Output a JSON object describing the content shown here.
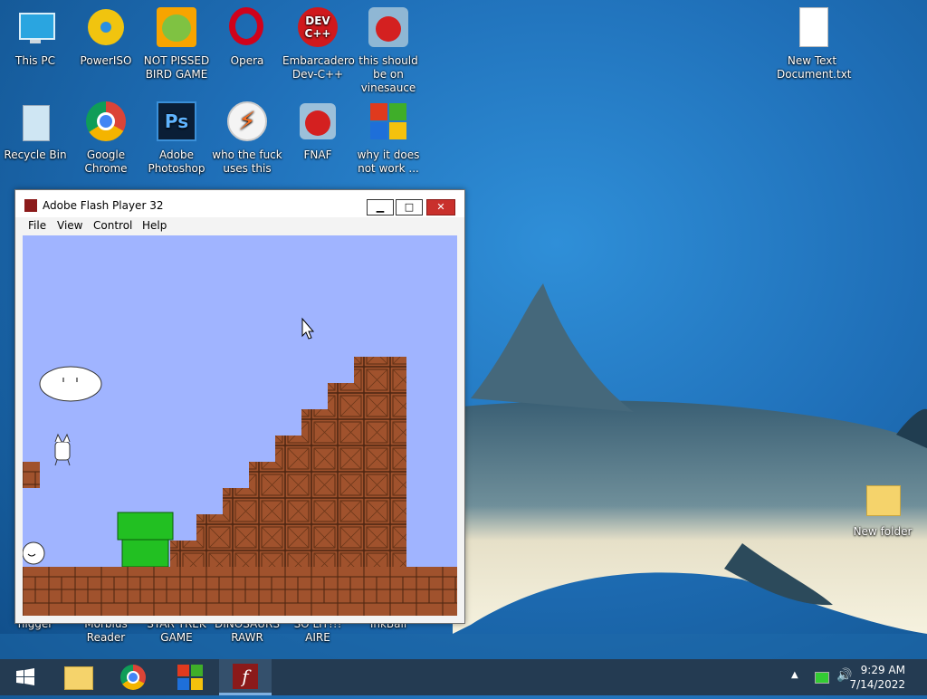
{
  "desktop": {
    "icons": [
      {
        "label": "This PC"
      },
      {
        "label": "PowerISO"
      },
      {
        "label": "NOT PISSED BIRD GAME"
      },
      {
        "label": "Opera"
      },
      {
        "label": "Embarcadero Dev-C++"
      },
      {
        "label": "this should be on vinesauce"
      },
      {
        "label": "New Text Document.txt"
      },
      {
        "label": "Recycle Bin"
      },
      {
        "label": "Google Chrome"
      },
      {
        "label": "Adobe Photoshop"
      },
      {
        "label": "who the fuck uses this"
      },
      {
        "label": "FNAF"
      },
      {
        "label": "why it does not work ..."
      },
      {
        "label": "New folder"
      },
      {
        "label": "nigger"
      },
      {
        "label": "Morbius Reader"
      },
      {
        "label": "STAR TREK GAME"
      },
      {
        "label": "DINOSAURS RAWR"
      },
      {
        "label": "SO LIT!!! AIRE"
      },
      {
        "label": "InkBall"
      }
    ]
  },
  "window": {
    "title": "Adobe Flash Player 32",
    "menu": [
      "File",
      "View",
      "Control",
      "Help"
    ],
    "minimize": "▁",
    "maximize": "□",
    "close": "✕"
  },
  "taskbar": {
    "time": "9:29 AM",
    "date": "7/14/2022"
  },
  "colors": {
    "stage_sky": "#a0b4ff",
    "brick": "#a0522d",
    "pipe": "#22c022",
    "taskbar": "#243b52"
  }
}
